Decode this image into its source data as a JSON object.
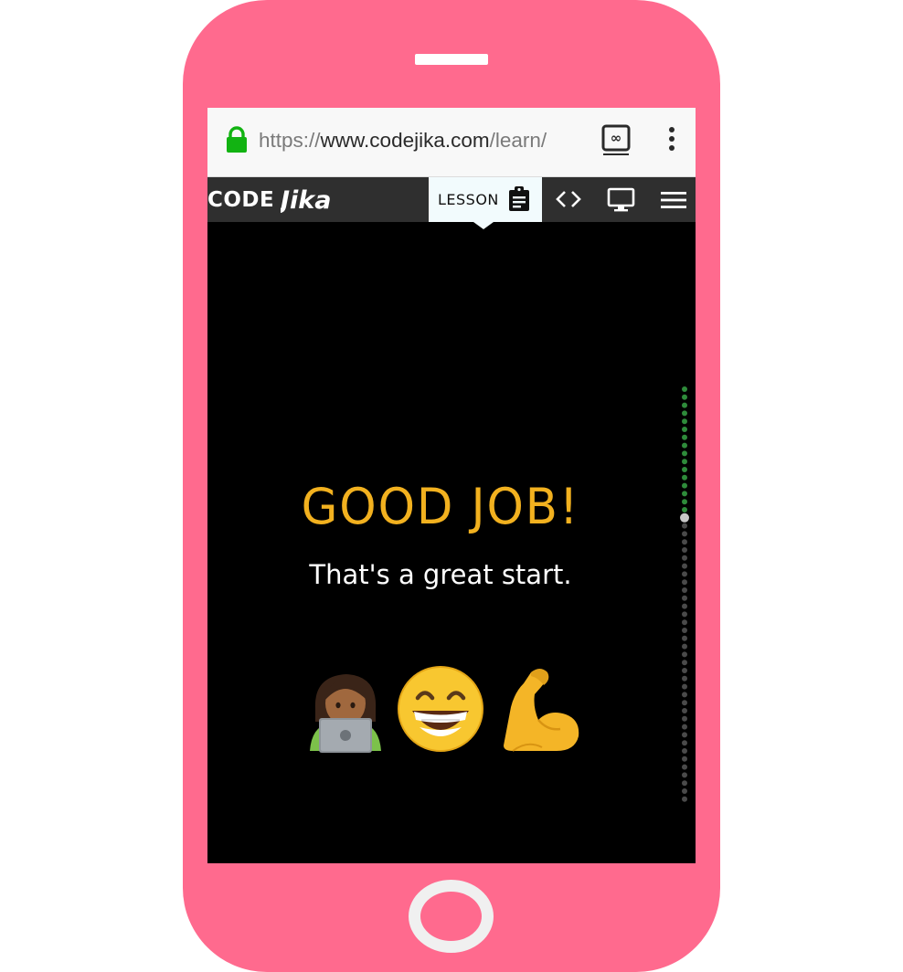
{
  "browser": {
    "url_scheme": "https://",
    "url_host": "www.codejika.com",
    "url_path": "/learn/",
    "tab_count": "∞"
  },
  "nav": {
    "logo_code": "CODE",
    "logo_jika": "Jika",
    "lesson_label": "LESSON",
    "code_symbol": "<>"
  },
  "content": {
    "title": "GOOD JOB!",
    "subtitle": "That's a great start.",
    "emojis": [
      "woman-technologist-emoji",
      "grinning-face-emoji",
      "flexed-biceps-emoji"
    ]
  },
  "progress": {
    "completed_steps": 16,
    "current_step": 17,
    "total_steps": 52
  },
  "colors": {
    "phone": "#ff6a8e",
    "title": "#f2b11f",
    "nav_bg": "#2f2f2f",
    "lesson_tab_bg": "#f2fbfd",
    "progress_done": "#2e8b3a",
    "progress_todo": "#4a4a4a",
    "progress_current": "#c8c8c8"
  }
}
